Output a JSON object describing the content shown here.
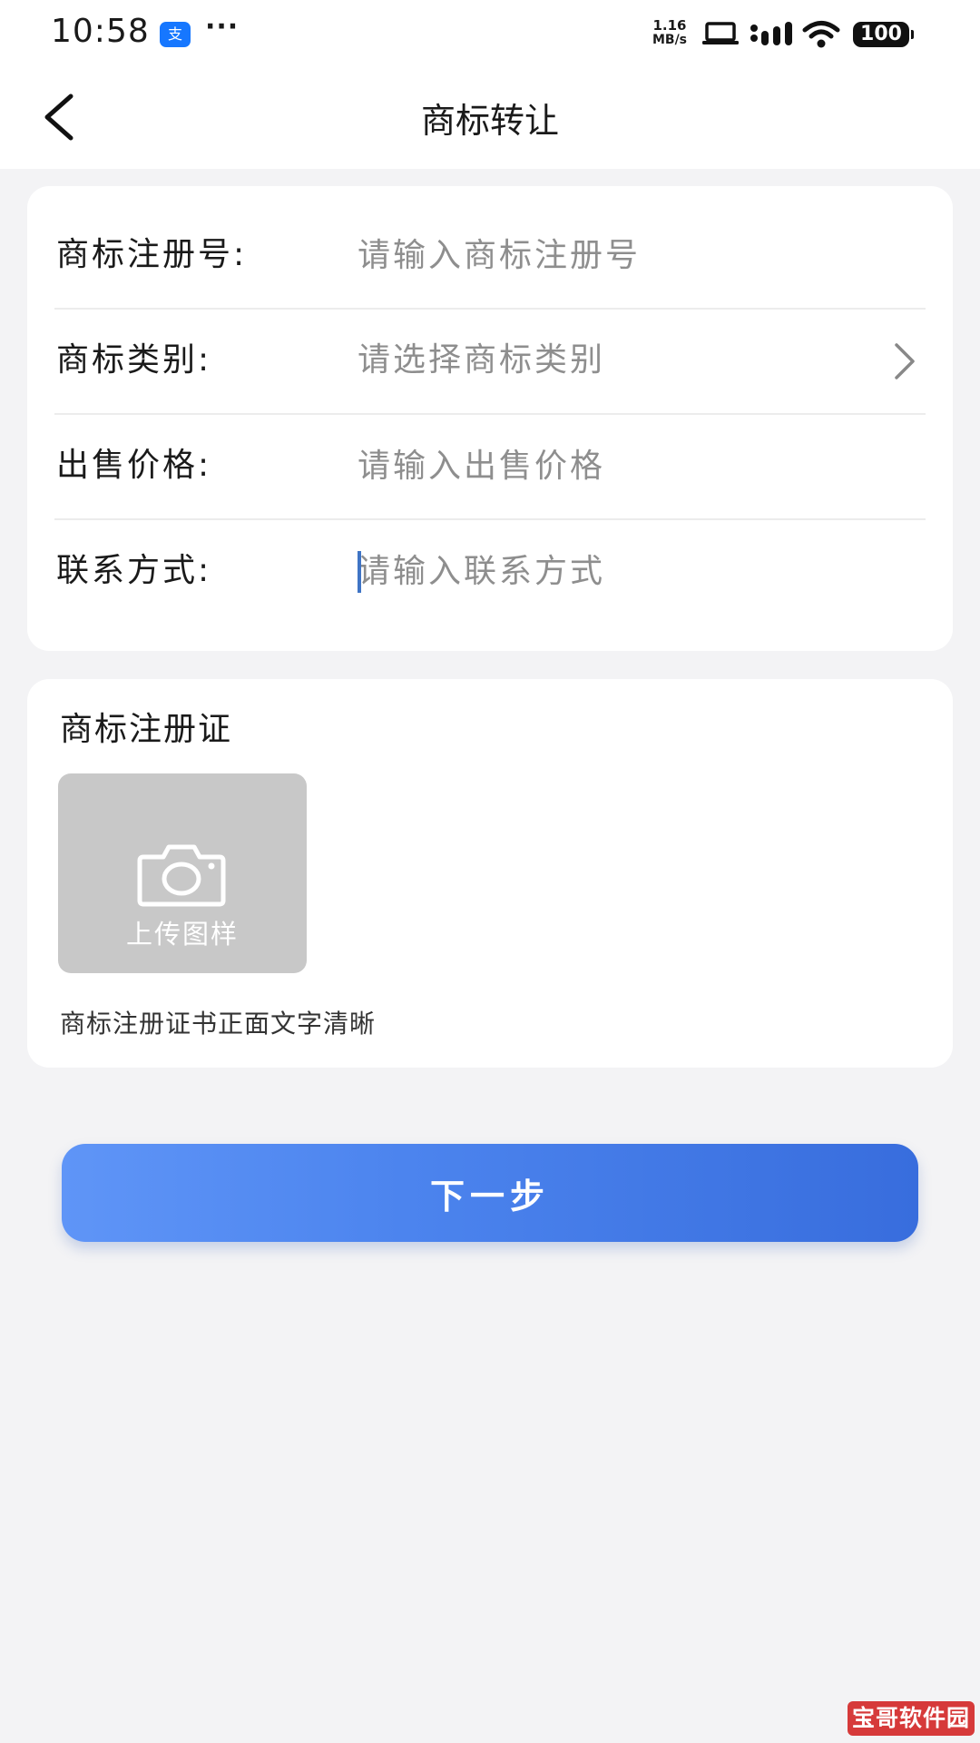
{
  "status_bar": {
    "time": "10:58",
    "alipay_glyph": "支",
    "more": "···",
    "net_speed_value": "1.16",
    "net_speed_unit": "MB/s",
    "battery": "100"
  },
  "header": {
    "title": "商标转让"
  },
  "form": {
    "rows": [
      {
        "label": "商标注册号:",
        "placeholder": "请输入商标注册号",
        "type": "input"
      },
      {
        "label": "商标类别:",
        "placeholder": "请选择商标类别",
        "type": "select"
      },
      {
        "label": "出售价格:",
        "placeholder": "请输入出售价格",
        "type": "input"
      },
      {
        "label": "联系方式:",
        "placeholder": "请输入联系方式",
        "type": "input",
        "focused": true
      }
    ]
  },
  "upload_section": {
    "title": "商标注册证",
    "upload_label": "上传图样",
    "hint": "商标注册证书正面文字清晰"
  },
  "next_button": {
    "label": "下一步"
  },
  "watermark": {
    "text": "宝哥软件园"
  },
  "colors": {
    "background": "#f3f3f5",
    "card": "#ffffff",
    "button_start": "#5f95f7",
    "button_end": "#386ddd",
    "cursor": "#3f74c5",
    "placeholder": "#8e8e8e",
    "watermark": "#d63a3a"
  },
  "icons": {
    "back": "chevron-left-icon",
    "category_arrow": "chevron-right-icon",
    "upload": "camera-icon",
    "laptop": "laptop-icon",
    "signal": "signal-icon",
    "wifi": "wifi-icon"
  }
}
